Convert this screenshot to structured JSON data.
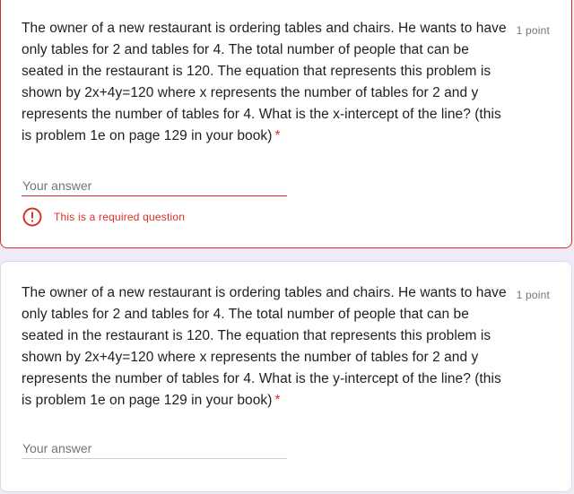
{
  "questions": [
    {
      "text": "The owner of a new restaurant is ordering tables and chairs. He wants to have only tables for 2 and tables for 4. The total number of people that can be seated in the restaurant is 120. The equation that represents this problem is shown by 2x+4y=120 where x represents the number of tables for 2 and y represents the number of tables for 4. What is the x-intercept of the line? (this is problem 1e on page 129 in your book)",
      "required_marker": "*",
      "points": "1 point",
      "answer_placeholder": "Your answer",
      "answer_value": "",
      "error_message": "This is a required question",
      "error_icon": "exclamation-circle-icon",
      "has_error": true
    },
    {
      "text": "The owner of a new restaurant is ordering tables and chairs. He wants to have only tables for 2 and tables for 4. The total number of people that can be seated in the restaurant is 120. The equation that represents this problem is shown by 2x+4y=120 where x represents the number of tables for 2 and y represents the number of tables for 4. What is the y-intercept of the line? (this is problem 1e on page 129 in your book)",
      "required_marker": "*",
      "points": "1 point",
      "answer_placeholder": "Your answer",
      "answer_value": "",
      "has_error": false
    }
  ],
  "colors": {
    "background": "#f0ebf8",
    "card": "#ffffff",
    "error": "#d93025",
    "text": "#202124",
    "muted": "#70757a"
  }
}
